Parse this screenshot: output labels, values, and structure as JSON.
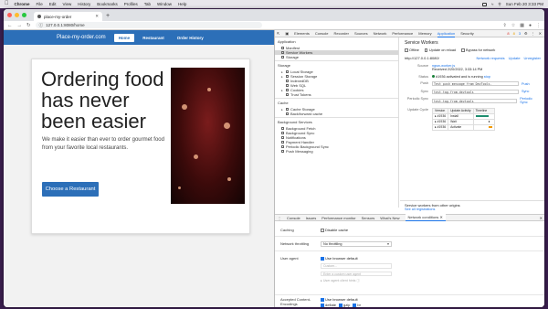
{
  "menubar": {
    "app": "Chrome",
    "items": [
      "File",
      "Edit",
      "View",
      "History",
      "Bookmarks",
      "Profiles",
      "Tab",
      "Window",
      "Help"
    ],
    "clock": "Sun Feb 20  3:33 PM"
  },
  "browser": {
    "tab_title": "place-my-order",
    "url": "127.0.0.1:8080/home"
  },
  "site": {
    "brand": "Place-my-order.com",
    "nav": [
      "Home",
      "Restaurant",
      "Order History"
    ],
    "headline": "Ordering food has never been easier",
    "subtext": "We make it easier than ever to order gourmet food from your favorite local restaurants.",
    "cta": "Choose a Restaurant"
  },
  "devtools": {
    "tabs": [
      "Elements",
      "Console",
      "Recorder",
      "Sources",
      "Network",
      "Performance",
      "Memory",
      "Application",
      "Security"
    ],
    "active_tab": "Application",
    "badges": {
      "errors": "8",
      "warnings": "8",
      "info": "3"
    },
    "sidebar": {
      "application_header": "Application",
      "application_items": [
        "Manifest",
        "Service Workers",
        "Storage"
      ],
      "storage_header": "Storage",
      "storage_items": [
        "Local Storage",
        "Session Storage",
        "IndexedDB",
        "Web SQL",
        "Cookies",
        "Trust Tokens"
      ],
      "cache_header": "Cache",
      "cache_items": [
        "Cache Storage",
        "Back/forward cache"
      ],
      "bg_header": "Background Services",
      "bg_items": [
        "Background Fetch",
        "Background Sync",
        "Notifications",
        "Payment Handler",
        "Periodic Background Sync",
        "Push Messaging"
      ]
    },
    "sw": {
      "title": "Service Workers",
      "options": [
        "Offline",
        "Update on reload",
        "Bypass for network"
      ],
      "origin": "http://127.0.0.1:8080/",
      "origin_links": [
        "Network requests",
        "Update",
        "Unregister"
      ],
      "source_label": "Source",
      "source_value": "ngsw-worker.js",
      "received": "Received 2/20/2022, 3:33:14 PM",
      "status_label": "Status",
      "status_value": "#1936 activated and is running",
      "status_action": "stop",
      "push_label": "Push",
      "push_value": "Test push message from DevTools.",
      "push_action": "Push",
      "sync_label": "Sync",
      "sync_value": "test-tag-from-devtools",
      "sync_action": "Sync",
      "psync_label": "Periodic Sync",
      "psync_value": "test-tag-from-devtools",
      "psync_action": "Periodic Sync",
      "uc_label": "Update Cycle",
      "uc_headers": [
        "Version",
        "Update Activity",
        "Timeline"
      ],
      "uc_rows": [
        {
          "version": "#1936",
          "activity": "Install"
        },
        {
          "version": "#1936",
          "activity": "Wait"
        },
        {
          "version": "#1936",
          "activity": "Activate"
        }
      ],
      "other_title": "Service workers from other origins",
      "other_link": "See all registrations"
    },
    "drawer_tabs": [
      "Console",
      "Issues",
      "Performance monitor",
      "Sensors",
      "What's New",
      "Network conditions"
    ],
    "drawer_active": "Network conditions",
    "nc": {
      "caching_label": "Caching",
      "caching_option": "Disable cache",
      "throttling_label": "Network throttling",
      "throttling_value": "No throttling",
      "ua_label": "User agent",
      "ua_option": "Use browser default",
      "ua_custom": "Custom...",
      "ua_placeholder": "Enter a custom user agent",
      "ua_hints": "User agent client hints",
      "enc_label": "Accepted Content-Encodings",
      "enc_option": "Use browser default",
      "enc_items": [
        "deflate",
        "gzip",
        "br"
      ]
    }
  },
  "colors": {
    "brand_blue": "#2c6fb8",
    "devtools_accent": "#1a73e8"
  }
}
